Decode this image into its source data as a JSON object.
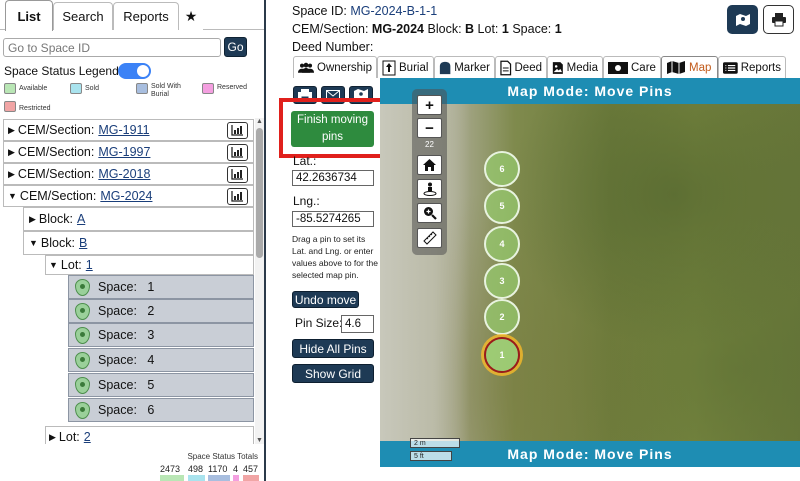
{
  "left_panel": {
    "tabs": [
      {
        "label": "List",
        "active": true
      },
      {
        "label": "Search"
      },
      {
        "label": "Reports"
      },
      {
        "label": "★"
      }
    ],
    "search": {
      "placeholder": "Go to Space ID",
      "go_label": "Go"
    },
    "legend": {
      "title": "Space Status Legend:",
      "items": [
        {
          "label": "Available",
          "color": "#b9e6b5"
        },
        {
          "label": "Sold",
          "color": "#a9e3ee"
        },
        {
          "label": "Sold With Burial",
          "color": "#a8bedf"
        },
        {
          "label": "Reserved",
          "color": "#f49fe0"
        },
        {
          "label": "Restricted",
          "color": "#f1a5a5"
        }
      ]
    },
    "tree": {
      "cem_prefix": "CEM/Section:",
      "sections": [
        "MG-1911",
        "MG-1997",
        "MG-2018",
        "MG-2024"
      ],
      "block_prefix": "Block:",
      "blocks": [
        "A",
        "B"
      ],
      "lot_prefix": "Lot:",
      "lots": [
        "1",
        "2"
      ],
      "space_prefix": "Space:",
      "spaces": [
        "1",
        "2",
        "3",
        "4",
        "5",
        "6"
      ]
    },
    "totals": {
      "title": "Space Status Totals",
      "values": [
        "2473",
        "498",
        "1170",
        "4",
        "457"
      ]
    }
  },
  "header": {
    "space_id_label": "Space ID:",
    "space_id": "MG-2024-B-1-1",
    "cem_label": "CEM/Section:",
    "cem": "MG-2024",
    "block_label": "Block:",
    "block": "B",
    "lot_label": "Lot:",
    "lot": "1",
    "space_label": "Space:",
    "space": "1",
    "deed_label": "Deed Number:"
  },
  "tabs": [
    {
      "label": "Ownership",
      "icon": "people-icon"
    },
    {
      "label": "Burial",
      "icon": "burial-icon"
    },
    {
      "label": "Marker",
      "icon": "headstone-icon"
    },
    {
      "label": "Deed",
      "icon": "document-icon"
    },
    {
      "label": "Media",
      "icon": "image-icon"
    },
    {
      "label": "Care",
      "icon": "money-icon"
    },
    {
      "label": "Map",
      "icon": "map-icon",
      "active": true
    },
    {
      "label": "Reports",
      "icon": "list-icon"
    }
  ],
  "map_controls": {
    "finish_label": "Finish moving pins",
    "lat_label": "Lat.:",
    "lat_value": "42.2636734",
    "lng_label": "Lng.:",
    "lng_value": "-85.5274265",
    "help_text": "Drag a pin to set its Lat. and Lng. or enter values above to for the selected map pin.",
    "undo_label": "Undo move",
    "pin_size_label": "Pin Size:",
    "pin_size_value": "4.6",
    "hide_pins_label": "Hide All Pins",
    "show_grid_label": "Show Grid"
  },
  "map": {
    "mode_text": "Map Mode: Move Pins",
    "zoom_level": "22",
    "pins": [
      "6",
      "5",
      "4",
      "3",
      "2",
      "1"
    ],
    "selected_pin": "1",
    "scale_m": "2 m",
    "scale_ft": "5 ft"
  },
  "colors": {
    "accent": "#1e3a55",
    "map_bar": "#1e8db3",
    "finish": "#2e8b3e",
    "highlight": "#e0201c"
  }
}
